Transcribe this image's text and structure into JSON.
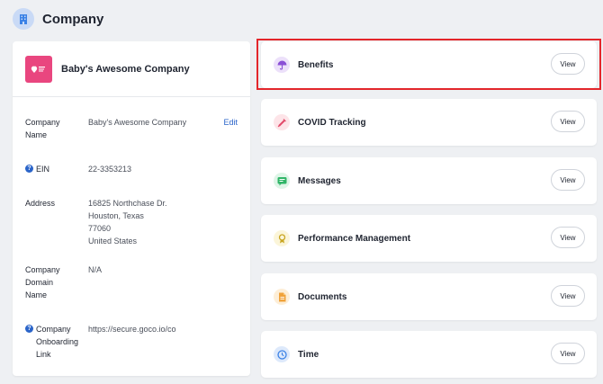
{
  "header": {
    "title": "Company",
    "icon": "building-icon"
  },
  "company": {
    "logo_icon": "heart-logo-icon",
    "name": "Baby's Awesome Company",
    "fields": [
      {
        "label": "Company\nName",
        "value": "Baby's Awesome Company",
        "action": "Edit"
      },
      {
        "label": "EIN",
        "value": "22-3353213",
        "help": "?"
      },
      {
        "label": "Address",
        "value": "16825 Northchase Dr.\nHouston, Texas\n77060\nUnited States"
      },
      {
        "label": "Company\nDomain\nName",
        "value": "N/A"
      },
      {
        "label": "Company\nOnboarding\nLink",
        "value": "https://secure.goco.io/co",
        "help": "?"
      }
    ]
  },
  "modules": [
    {
      "label": "Benefits",
      "icon": "umbrella-icon",
      "color": "#8a4fd6",
      "bg": "#ece0fa",
      "button": "View"
    },
    {
      "label": "COVID Tracking",
      "icon": "syringe-icon",
      "color": "#e24a6a",
      "bg": "#fde4e8",
      "button": "View"
    },
    {
      "label": "Messages",
      "icon": "chat-icon",
      "color": "#2fb567",
      "bg": "#def5e7",
      "button": "View"
    },
    {
      "label": "Performance Management",
      "icon": "award-icon",
      "color": "#c9a622",
      "bg": "#fbf5d9",
      "button": "View"
    },
    {
      "label": "Documents",
      "icon": "document-icon",
      "color": "#f0a23a",
      "bg": "#fdeed7",
      "button": "View"
    },
    {
      "label": "Time",
      "icon": "clock-icon",
      "color": "#3b82e6",
      "bg": "#dde9fb",
      "button": "View"
    }
  ],
  "highlight_color": "#e3262b"
}
